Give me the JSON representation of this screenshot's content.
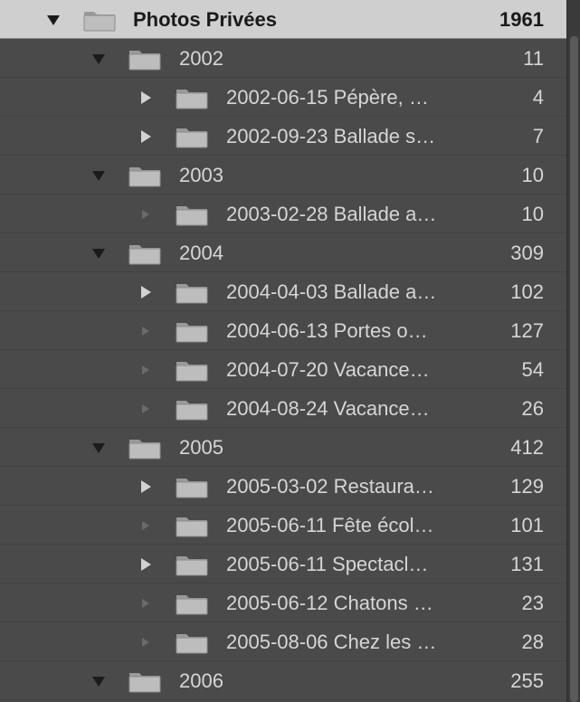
{
  "folder_tree": [
    {
      "level": 0,
      "toggle": "expanded",
      "icon": "folder-icon",
      "name": "Photos Privées",
      "count": "1961"
    },
    {
      "level": 1,
      "toggle": "expanded",
      "icon": "folder-icon",
      "name": "2002",
      "count": "11"
    },
    {
      "level": 2,
      "toggle": "collapsed",
      "icon": "folder-icon",
      "name": "2002-06-15 Pépère, …",
      "count": "4"
    },
    {
      "level": 2,
      "toggle": "collapsed",
      "icon": "folder-icon",
      "name": "2002-09-23 Ballade s…",
      "count": "7"
    },
    {
      "level": 1,
      "toggle": "expanded",
      "icon": "folder-icon",
      "name": "2003",
      "count": "10"
    },
    {
      "level": 2,
      "toggle": "empty",
      "icon": "folder-icon",
      "name": "2003-02-28 Ballade a…",
      "count": "10"
    },
    {
      "level": 1,
      "toggle": "expanded",
      "icon": "folder-icon",
      "name": "2004",
      "count": "309"
    },
    {
      "level": 2,
      "toggle": "collapsed",
      "icon": "folder-icon",
      "name": "2004-04-03 Ballade a…",
      "count": "102"
    },
    {
      "level": 2,
      "toggle": "empty",
      "icon": "folder-icon",
      "name": "2004-06-13 Portes o…",
      "count": "127"
    },
    {
      "level": 2,
      "toggle": "empty",
      "icon": "folder-icon",
      "name": "2004-07-20 Vacance…",
      "count": "54"
    },
    {
      "level": 2,
      "toggle": "empty",
      "icon": "folder-icon",
      "name": "2004-08-24 Vacance…",
      "count": "26"
    },
    {
      "level": 1,
      "toggle": "expanded",
      "icon": "folder-icon",
      "name": "2005",
      "count": "412"
    },
    {
      "level": 2,
      "toggle": "collapsed",
      "icon": "folder-icon",
      "name": "2005-03-02 Restaura…",
      "count": "129"
    },
    {
      "level": 2,
      "toggle": "empty",
      "icon": "folder-icon",
      "name": "2005-06-11 Fête écol…",
      "count": "101"
    },
    {
      "level": 2,
      "toggle": "collapsed",
      "icon": "folder-icon",
      "name": "2005-06-11 Spectacl…",
      "count": "131"
    },
    {
      "level": 2,
      "toggle": "empty",
      "icon": "folder-icon",
      "name": "2005-06-12 Chatons …",
      "count": "23"
    },
    {
      "level": 2,
      "toggle": "empty",
      "icon": "folder-icon",
      "name": "2005-08-06 Chez les …",
      "count": "28"
    },
    {
      "level": 1,
      "toggle": "expanded",
      "icon": "folder-icon",
      "name": "2006",
      "count": "255"
    }
  ],
  "colors": {
    "panel_bg": "#4a4a4a",
    "root_row_bg": "#cfcfcf",
    "text": "#d6d6d6",
    "root_text": "#1a1a1a"
  }
}
